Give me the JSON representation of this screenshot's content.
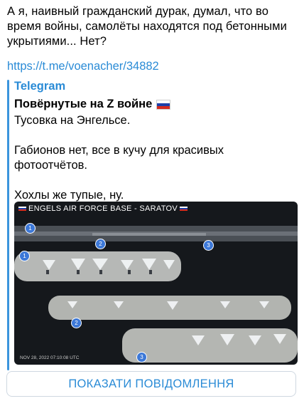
{
  "message": {
    "text": "А я, наивный гражданский дурак, думал, что во время войны, самолёты находятся под бетонными укрытиями... Нет?",
    "link": "https://t.me/voenacher/34882"
  },
  "preview": {
    "site_name": "Telegram",
    "title": "Повёрнутые на Z войне",
    "title_flag": "russia-flag-icon",
    "description": "Тусовка на Энгельсе.\n\nГабионов нет, все в кучу для красивых фотоотчётов.\n\nХохлы же тупые, ну.",
    "image": {
      "caption": "ENGELS AIR FORCE BASE - SARATOV",
      "date": "NOV 28, 2022 07:10:08 UTC",
      "markers": [
        "1",
        "2",
        "3",
        "1",
        "2",
        "3"
      ]
    }
  },
  "button": {
    "label": "ПОКАЗАТИ ПОВІДОМЛЕННЯ"
  },
  "colors": {
    "link": "#2a8bd6",
    "accent_bar": "#3b95dd",
    "flag_white": "#ffffff",
    "flag_blue": "#1c3fa8",
    "flag_red": "#d52b1e"
  }
}
